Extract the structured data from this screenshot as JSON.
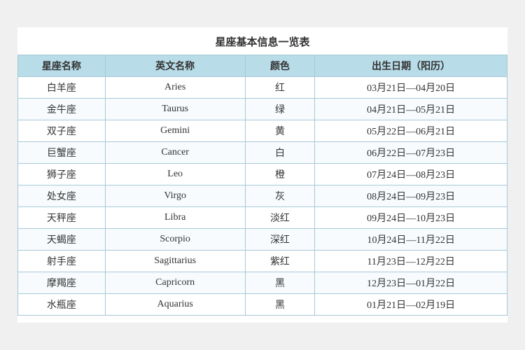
{
  "title": "星座基本信息一览表",
  "headers": {
    "name": "星座名称",
    "english": "英文名称",
    "color": "颜色",
    "date": "出生日期（阳历）"
  },
  "rows": [
    {
      "name": "白羊座",
      "english": "Aries",
      "color": "红",
      "date": "03月21日—04月20日"
    },
    {
      "name": "金牛座",
      "english": "Taurus",
      "color": "绿",
      "date": "04月21日—05月21日"
    },
    {
      "name": "双子座",
      "english": "Gemini",
      "color": "黄",
      "date": "05月22日—06月21日"
    },
    {
      "name": "巨蟹座",
      "english": "Cancer",
      "color": "白",
      "date": "06月22日—07月23日"
    },
    {
      "name": "狮子座",
      "english": "Leo",
      "color": "橙",
      "date": "07月24日—08月23日"
    },
    {
      "name": "处女座",
      "english": "Virgo",
      "color": "灰",
      "date": "08月24日—09月23日"
    },
    {
      "name": "天秤座",
      "english": "Libra",
      "color": "淡红",
      "date": "09月24日—10月23日"
    },
    {
      "name": "天蝎座",
      "english": "Scorpio",
      "color": "深红",
      "date": "10月24日—11月22日"
    },
    {
      "name": "射手座",
      "english": "Sagittarius",
      "color": "紫红",
      "date": "11月23日—12月22日"
    },
    {
      "name": "摩羯座",
      "english": "Capricorn",
      "color": "黑",
      "date": "12月23日—01月22日"
    },
    {
      "name": "水瓶座",
      "english": "Aquarius",
      "color": "黑",
      "date": "01月21日—02月19日"
    }
  ]
}
